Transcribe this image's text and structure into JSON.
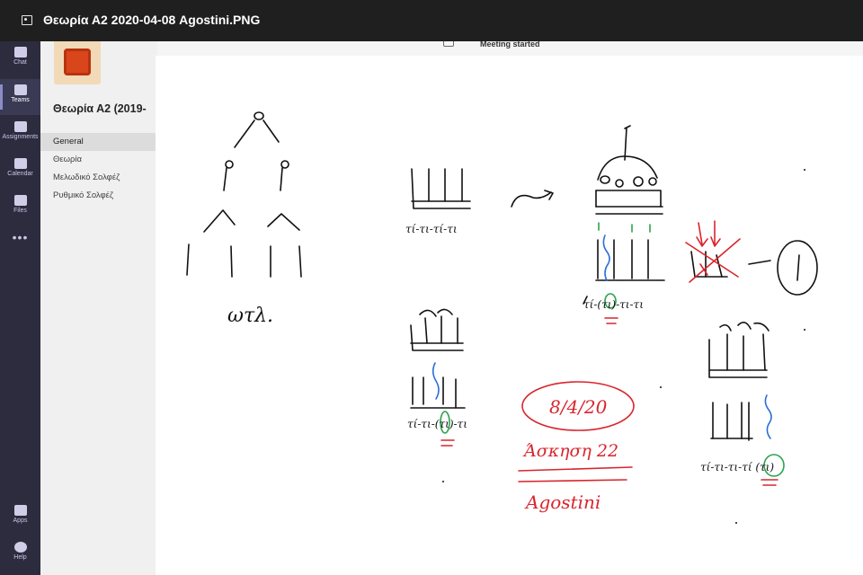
{
  "viewer": {
    "title": "Θεωρία Α2 2020-04-08 Agostini.PNG",
    "icon": "image-file-icon"
  },
  "rail": {
    "items": [
      {
        "label": "Chat",
        "icon": "chat-icon"
      },
      {
        "label": "Teams",
        "icon": "teams-icon",
        "active": true
      },
      {
        "label": "Assignments",
        "icon": "assignments-icon"
      },
      {
        "label": "Calendar",
        "icon": "calendar-icon"
      },
      {
        "label": "Files",
        "icon": "files-icon"
      },
      {
        "label": "Apps",
        "icon": "apps-icon"
      },
      {
        "label": "Help",
        "icon": "help-icon"
      }
    ],
    "more": "•••"
  },
  "team": {
    "name": "Θεωρία Α2 (2019-",
    "channels": [
      {
        "label": "General",
        "active": true
      },
      {
        "label": "Θεωρία"
      },
      {
        "label": "Μελωδικό Σολφέζ"
      },
      {
        "label": "Ρυθμικό Σολφέζ"
      }
    ]
  },
  "meeting": {
    "status": "Meeting started",
    "icon": "video-camera-icon"
  },
  "whiteboard": {
    "abbrev": "ωτλ.",
    "rhythm_a": "τί-τι-τί-τι",
    "rhythm_b": "τί-(τι)-τι-τι",
    "rhythm_c": "τί-τι-(τι)-τι",
    "rhythm_d": "τί-τι-τι-τί (τι)",
    "date": "8/4/20",
    "exercise": "Άσκηση 22",
    "name": "Agostini",
    "colors": {
      "ink": "#111111",
      "red": "#d9252d",
      "green": "#2aa34a",
      "blue": "#2a6fd6"
    }
  }
}
